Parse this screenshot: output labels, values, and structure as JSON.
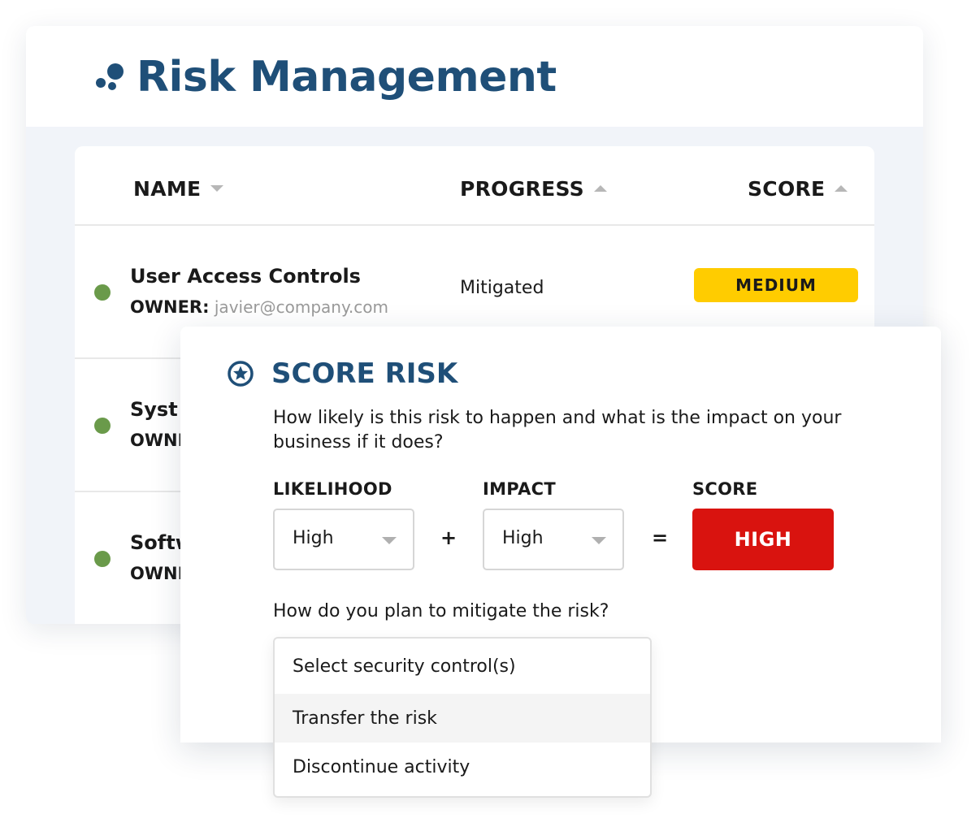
{
  "header": {
    "title": "Risk Management",
    "logo_icon": "dots-logo-icon",
    "accent_color": "#1f4f78"
  },
  "table": {
    "columns": [
      {
        "label": "NAME",
        "sort": "descending"
      },
      {
        "label": "PROGRESS",
        "sort": "ascending"
      },
      {
        "label": "SCORE",
        "sort": "ascending"
      }
    ],
    "owner_label": "OWNER:",
    "rows": [
      {
        "name": "User Access Controls",
        "owner": "javier@company.com",
        "progress": "Mitigated",
        "score": "MEDIUM",
        "status_color": "#6a9a4a",
        "score_color": "#ffcc00"
      },
      {
        "name": "Syst",
        "owner": "",
        "status_color": "#6a9a4a"
      },
      {
        "name": "Softw",
        "owner": "",
        "status_color": "#6a9a4a"
      }
    ],
    "rows_owner_partial": [
      "OWNE",
      "OWNE"
    ]
  },
  "modal": {
    "title": "SCORE RISK",
    "icon": "star-circle-icon",
    "question": "How likely is this risk to happen and what is the impact on your business if it does?",
    "likelihood": {
      "label": "LIKELIHOOD",
      "value": "High"
    },
    "impact": {
      "label": "IMPACT",
      "value": "High"
    },
    "score": {
      "label": "SCORE",
      "value": "HIGH",
      "color": "#d9130f"
    },
    "plus": "+",
    "equals": "=",
    "mitigate_question": "How do you plan to mitigate the risk?",
    "mitigation_options": [
      "Select security control(s)",
      "Transfer the risk",
      "Discontinue activity"
    ],
    "highlighted_option": "Transfer the risk"
  }
}
